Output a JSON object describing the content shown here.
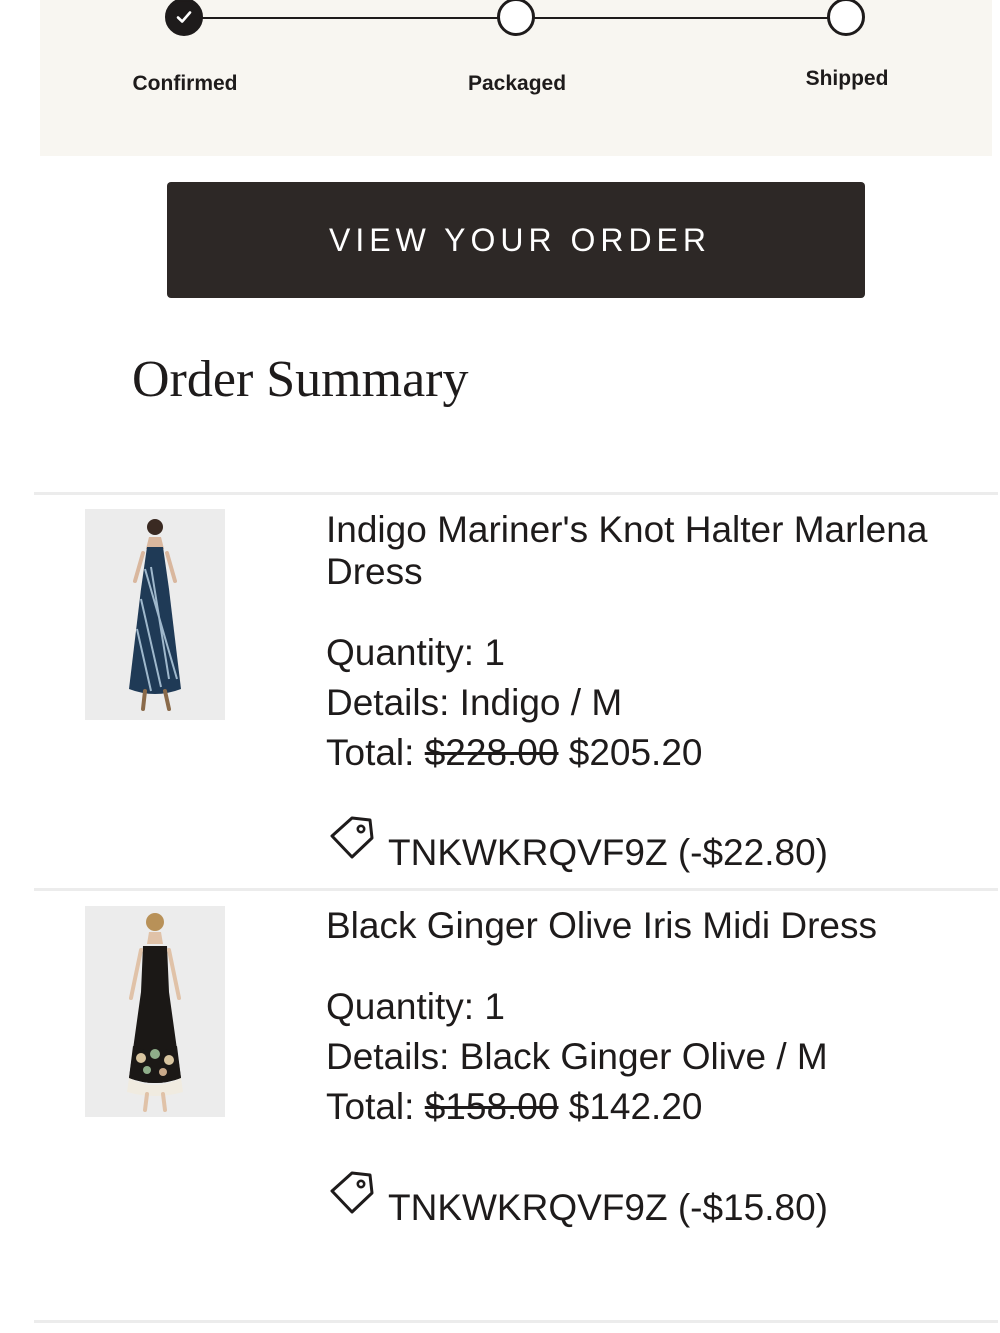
{
  "tracker": {
    "steps": [
      {
        "label": "Confirmed",
        "status": "complete"
      },
      {
        "label": "Packaged",
        "status": "pending"
      },
      {
        "label": "Shipped",
        "status": "pending"
      }
    ]
  },
  "actions": {
    "view_order_label": "VIEW YOUR ORDER"
  },
  "summary": {
    "title": "Order Summary",
    "items": [
      {
        "name": "Indigo Mariner's Knot Halter Marlena Dress",
        "quantity_label": "Quantity:",
        "quantity": "1",
        "details_label": "Details:",
        "details": "Indigo / M",
        "total_label": "Total:",
        "original_price": "$228.00",
        "sale_price": "$205.20",
        "discount_code": "TNKWKRQVF9Z (-$22.80)"
      },
      {
        "name": "Black Ginger Olive Iris Midi Dress",
        "quantity_label": "Quantity:",
        "quantity": "1",
        "details_label": "Details:",
        "details": "Black Ginger Olive / M",
        "total_label": "Total:",
        "original_price": "$158.00",
        "sale_price": "$142.20",
        "discount_code": "TNKWKRQVF9Z (-$15.80)"
      }
    ]
  },
  "colors": {
    "tracker_background": "#f8f6f1",
    "button_background": "#2d2826",
    "text": "#1e1b1b"
  },
  "icons": [
    "checkmark-icon",
    "price-tag-icon"
  ]
}
